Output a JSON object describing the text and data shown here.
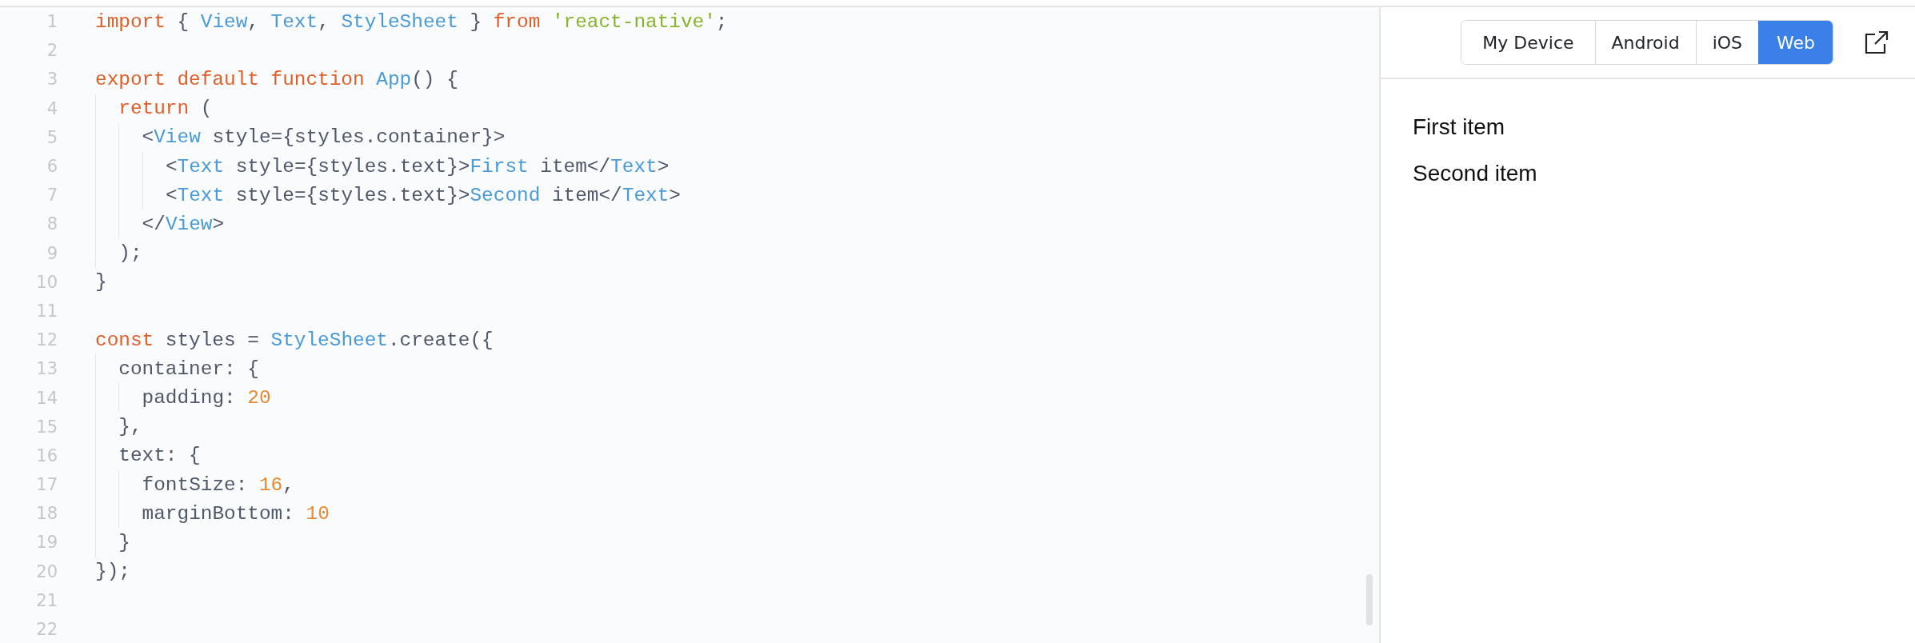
{
  "editor": {
    "lines": [
      {
        "number": "1",
        "tokens": [
          {
            "kind": "keyword",
            "text": "import"
          },
          {
            "kind": "plain",
            "text": " { "
          },
          {
            "kind": "type",
            "text": "View"
          },
          {
            "kind": "plain",
            "text": ", "
          },
          {
            "kind": "type",
            "text": "Text"
          },
          {
            "kind": "plain",
            "text": ", "
          },
          {
            "kind": "type",
            "text": "StyleSheet"
          },
          {
            "kind": "plain",
            "text": " } "
          },
          {
            "kind": "keyword",
            "text": "from "
          },
          {
            "kind": "string",
            "text": "'react-native'"
          },
          {
            "kind": "plain",
            "text": ";"
          }
        ]
      },
      {
        "number": "2"
      },
      {
        "number": "3",
        "tokens": [
          {
            "kind": "keyword",
            "text": "export default function "
          },
          {
            "kind": "type",
            "text": "App"
          },
          {
            "kind": "plain",
            "text": "() {"
          }
        ]
      },
      {
        "number": "4",
        "tokens": [
          {
            "kind": "keyword",
            "text": "  return"
          },
          {
            "kind": "plain",
            "text": " ("
          }
        ]
      },
      {
        "number": "5",
        "tokens": [
          {
            "kind": "plain",
            "text": "    <"
          },
          {
            "kind": "type",
            "text": "View"
          },
          {
            "kind": "plain",
            "text": " style={styles.container}>"
          }
        ]
      },
      {
        "number": "6",
        "tokens": [
          {
            "kind": "plain",
            "text": "      <"
          },
          {
            "kind": "type",
            "text": "Text"
          },
          {
            "kind": "plain",
            "text": " style={styles.text}>"
          },
          {
            "kind": "type",
            "text": "First"
          },
          {
            "kind": "plain",
            "text": " item</"
          },
          {
            "kind": "type",
            "text": "Text"
          },
          {
            "kind": "plain",
            "text": ">"
          }
        ]
      },
      {
        "number": "7",
        "tokens": [
          {
            "kind": "plain",
            "text": "      <"
          },
          {
            "kind": "type",
            "text": "Text"
          },
          {
            "kind": "plain",
            "text": " style={styles.text}>"
          },
          {
            "kind": "type",
            "text": "Second"
          },
          {
            "kind": "plain",
            "text": " item</"
          },
          {
            "kind": "type",
            "text": "Text"
          },
          {
            "kind": "plain",
            "text": ">"
          }
        ]
      },
      {
        "number": "8",
        "tokens": [
          {
            "kind": "plain",
            "text": "    </"
          },
          {
            "kind": "type",
            "text": "View"
          },
          {
            "kind": "plain",
            "text": ">"
          }
        ]
      },
      {
        "number": "9",
        "tokens": [
          {
            "kind": "plain",
            "text": "  );"
          }
        ]
      },
      {
        "number": "10",
        "tokens": [
          {
            "kind": "plain",
            "text": "}"
          }
        ]
      },
      {
        "number": "11"
      },
      {
        "number": "12",
        "tokens": [
          {
            "kind": "keyword",
            "text": "const"
          },
          {
            "kind": "plain",
            "text": " styles = "
          },
          {
            "kind": "type",
            "text": "StyleSheet"
          },
          {
            "kind": "plain",
            "text": ".create({"
          }
        ]
      },
      {
        "number": "13",
        "tokens": [
          {
            "kind": "plain",
            "text": "  container: {"
          }
        ]
      },
      {
        "number": "14",
        "tokens": [
          {
            "kind": "plain",
            "text": "    padding: "
          },
          {
            "kind": "number",
            "text": "20"
          }
        ]
      },
      {
        "number": "15",
        "tokens": [
          {
            "kind": "plain",
            "text": "  },"
          }
        ]
      },
      {
        "number": "16",
        "tokens": [
          {
            "kind": "plain",
            "text": "  text: {"
          }
        ]
      },
      {
        "number": "17",
        "tokens": [
          {
            "kind": "plain",
            "text": "    fontSize: "
          },
          {
            "kind": "number",
            "text": "16"
          },
          {
            "kind": "plain",
            "text": ","
          }
        ]
      },
      {
        "number": "18",
        "tokens": [
          {
            "kind": "plain",
            "text": "    marginBottom: "
          },
          {
            "kind": "number",
            "text": "10"
          }
        ]
      },
      {
        "number": "19",
        "tokens": [
          {
            "kind": "plain",
            "text": "  }"
          }
        ]
      },
      {
        "number": "20",
        "tokens": [
          {
            "kind": "plain",
            "text": "});"
          }
        ]
      },
      {
        "number": "21"
      },
      {
        "number": "22"
      }
    ]
  },
  "preview": {
    "platform_tabs": [
      {
        "label": "My Device",
        "selected": false
      },
      {
        "label": "Android",
        "selected": false
      },
      {
        "label": "iOS",
        "selected": false
      },
      {
        "label": "Web",
        "selected": true
      }
    ],
    "items": [
      "First item",
      "Second item"
    ]
  }
}
